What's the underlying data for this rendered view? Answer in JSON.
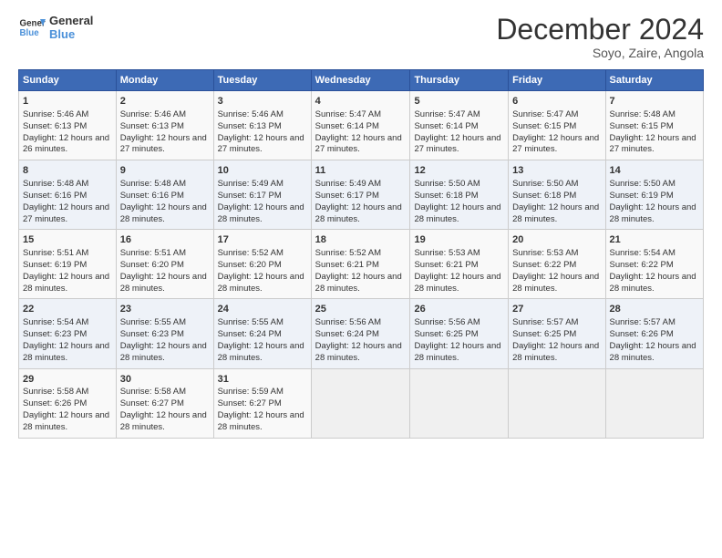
{
  "logo": {
    "line1": "General",
    "line2": "Blue"
  },
  "title": "December 2024",
  "subtitle": "Soyo, Zaire, Angola",
  "days_of_week": [
    "Sunday",
    "Monday",
    "Tuesday",
    "Wednesday",
    "Thursday",
    "Friday",
    "Saturday"
  ],
  "weeks": [
    [
      {
        "day": 1,
        "info": "Sunrise: 5:46 AM\nSunset: 6:13 PM\nDaylight: 12 hours and 26 minutes."
      },
      {
        "day": 2,
        "info": "Sunrise: 5:46 AM\nSunset: 6:13 PM\nDaylight: 12 hours and 27 minutes."
      },
      {
        "day": 3,
        "info": "Sunrise: 5:46 AM\nSunset: 6:13 PM\nDaylight: 12 hours and 27 minutes."
      },
      {
        "day": 4,
        "info": "Sunrise: 5:47 AM\nSunset: 6:14 PM\nDaylight: 12 hours and 27 minutes."
      },
      {
        "day": 5,
        "info": "Sunrise: 5:47 AM\nSunset: 6:14 PM\nDaylight: 12 hours and 27 minutes."
      },
      {
        "day": 6,
        "info": "Sunrise: 5:47 AM\nSunset: 6:15 PM\nDaylight: 12 hours and 27 minutes."
      },
      {
        "day": 7,
        "info": "Sunrise: 5:48 AM\nSunset: 6:15 PM\nDaylight: 12 hours and 27 minutes."
      }
    ],
    [
      {
        "day": 8,
        "info": "Sunrise: 5:48 AM\nSunset: 6:16 PM\nDaylight: 12 hours and 27 minutes."
      },
      {
        "day": 9,
        "info": "Sunrise: 5:48 AM\nSunset: 6:16 PM\nDaylight: 12 hours and 28 minutes."
      },
      {
        "day": 10,
        "info": "Sunrise: 5:49 AM\nSunset: 6:17 PM\nDaylight: 12 hours and 28 minutes."
      },
      {
        "day": 11,
        "info": "Sunrise: 5:49 AM\nSunset: 6:17 PM\nDaylight: 12 hours and 28 minutes."
      },
      {
        "day": 12,
        "info": "Sunrise: 5:50 AM\nSunset: 6:18 PM\nDaylight: 12 hours and 28 minutes."
      },
      {
        "day": 13,
        "info": "Sunrise: 5:50 AM\nSunset: 6:18 PM\nDaylight: 12 hours and 28 minutes."
      },
      {
        "day": 14,
        "info": "Sunrise: 5:50 AM\nSunset: 6:19 PM\nDaylight: 12 hours and 28 minutes."
      }
    ],
    [
      {
        "day": 15,
        "info": "Sunrise: 5:51 AM\nSunset: 6:19 PM\nDaylight: 12 hours and 28 minutes."
      },
      {
        "day": 16,
        "info": "Sunrise: 5:51 AM\nSunset: 6:20 PM\nDaylight: 12 hours and 28 minutes."
      },
      {
        "day": 17,
        "info": "Sunrise: 5:52 AM\nSunset: 6:20 PM\nDaylight: 12 hours and 28 minutes."
      },
      {
        "day": 18,
        "info": "Sunrise: 5:52 AM\nSunset: 6:21 PM\nDaylight: 12 hours and 28 minutes."
      },
      {
        "day": 19,
        "info": "Sunrise: 5:53 AM\nSunset: 6:21 PM\nDaylight: 12 hours and 28 minutes."
      },
      {
        "day": 20,
        "info": "Sunrise: 5:53 AM\nSunset: 6:22 PM\nDaylight: 12 hours and 28 minutes."
      },
      {
        "day": 21,
        "info": "Sunrise: 5:54 AM\nSunset: 6:22 PM\nDaylight: 12 hours and 28 minutes."
      }
    ],
    [
      {
        "day": 22,
        "info": "Sunrise: 5:54 AM\nSunset: 6:23 PM\nDaylight: 12 hours and 28 minutes."
      },
      {
        "day": 23,
        "info": "Sunrise: 5:55 AM\nSunset: 6:23 PM\nDaylight: 12 hours and 28 minutes."
      },
      {
        "day": 24,
        "info": "Sunrise: 5:55 AM\nSunset: 6:24 PM\nDaylight: 12 hours and 28 minutes."
      },
      {
        "day": 25,
        "info": "Sunrise: 5:56 AM\nSunset: 6:24 PM\nDaylight: 12 hours and 28 minutes."
      },
      {
        "day": 26,
        "info": "Sunrise: 5:56 AM\nSunset: 6:25 PM\nDaylight: 12 hours and 28 minutes."
      },
      {
        "day": 27,
        "info": "Sunrise: 5:57 AM\nSunset: 6:25 PM\nDaylight: 12 hours and 28 minutes."
      },
      {
        "day": 28,
        "info": "Sunrise: 5:57 AM\nSunset: 6:26 PM\nDaylight: 12 hours and 28 minutes."
      }
    ],
    [
      {
        "day": 29,
        "info": "Sunrise: 5:58 AM\nSunset: 6:26 PM\nDaylight: 12 hours and 28 minutes."
      },
      {
        "day": 30,
        "info": "Sunrise: 5:58 AM\nSunset: 6:27 PM\nDaylight: 12 hours and 28 minutes."
      },
      {
        "day": 31,
        "info": "Sunrise: 5:59 AM\nSunset: 6:27 PM\nDaylight: 12 hours and 28 minutes."
      },
      null,
      null,
      null,
      null
    ]
  ]
}
